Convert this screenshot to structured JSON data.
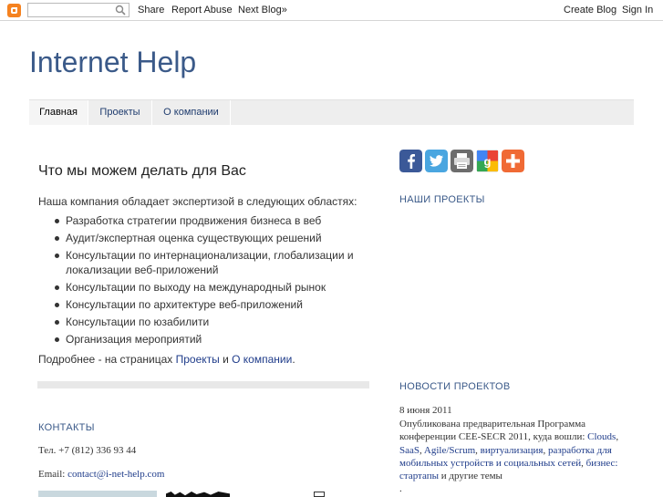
{
  "navbar": {
    "search_placeholder": "",
    "share": "Share",
    "report_abuse": "Report Abuse",
    "next_blog": "Next Blog»",
    "create_blog": "Create Blog",
    "sign_in": "Sign In"
  },
  "header": {
    "title": "Internet Help"
  },
  "tabs": [
    {
      "label": "Главная",
      "active": true
    },
    {
      "label": "Проекты",
      "active": false
    },
    {
      "label": "О компании",
      "active": false
    }
  ],
  "post": {
    "title": "Что мы можем делать для Вас",
    "intro": "Наша компания обладает экспертизой в следующих областях:",
    "items": [
      "Разработка стратегии продвижения бизнеса в веб",
      "Аудит/экспертная оценка существующих решений",
      "Консультации по интернационализации, глобализации и локализации веб-приложений",
      "Консультации по выходу на международный рынок",
      "Консультации по архитектуре веб-приложений",
      "Консультации по юзабилити",
      "Организация мероприятий"
    ],
    "more_prefix": "Подробнее - на страницах ",
    "more_link1": "Проекты",
    "more_and": " и ",
    "more_link2": "О компании",
    "more_suffix": "."
  },
  "contacts": {
    "heading": "КОНТАКТЫ",
    "phone": "Тел. +7 (812) 336 93 44",
    "email_label": "Email: ",
    "email": "contact@i-net-help.com"
  },
  "sidebar": {
    "share_icons": [
      "facebook-icon",
      "twitter-icon",
      "print-icon",
      "google-icon",
      "more-icon"
    ],
    "projects_heading": "НАШИ ПРОЕКТЫ",
    "news_heading": "НОВОСТИ ПРОЕКТОВ",
    "news_date": "8 июня 2011",
    "news_text_start": "Опубликована предварительная Программа конференции CEE-SECR 2011, куда вошли: ",
    "news_links": [
      "Clouds",
      "SaaS",
      "Agile/Scrum",
      "виртуализация",
      "разработка для мобильных устройств и социальных сетей",
      "бизнес: стартапы"
    ],
    "news_sep": ", ",
    "news_text_end": " и другие темы",
    "news_more": "."
  },
  "colors": {
    "title": "#3b5a89",
    "link": "#1f3c8a",
    "tab_bg": "#eeeeee",
    "blogger_orange": "#f58220"
  }
}
